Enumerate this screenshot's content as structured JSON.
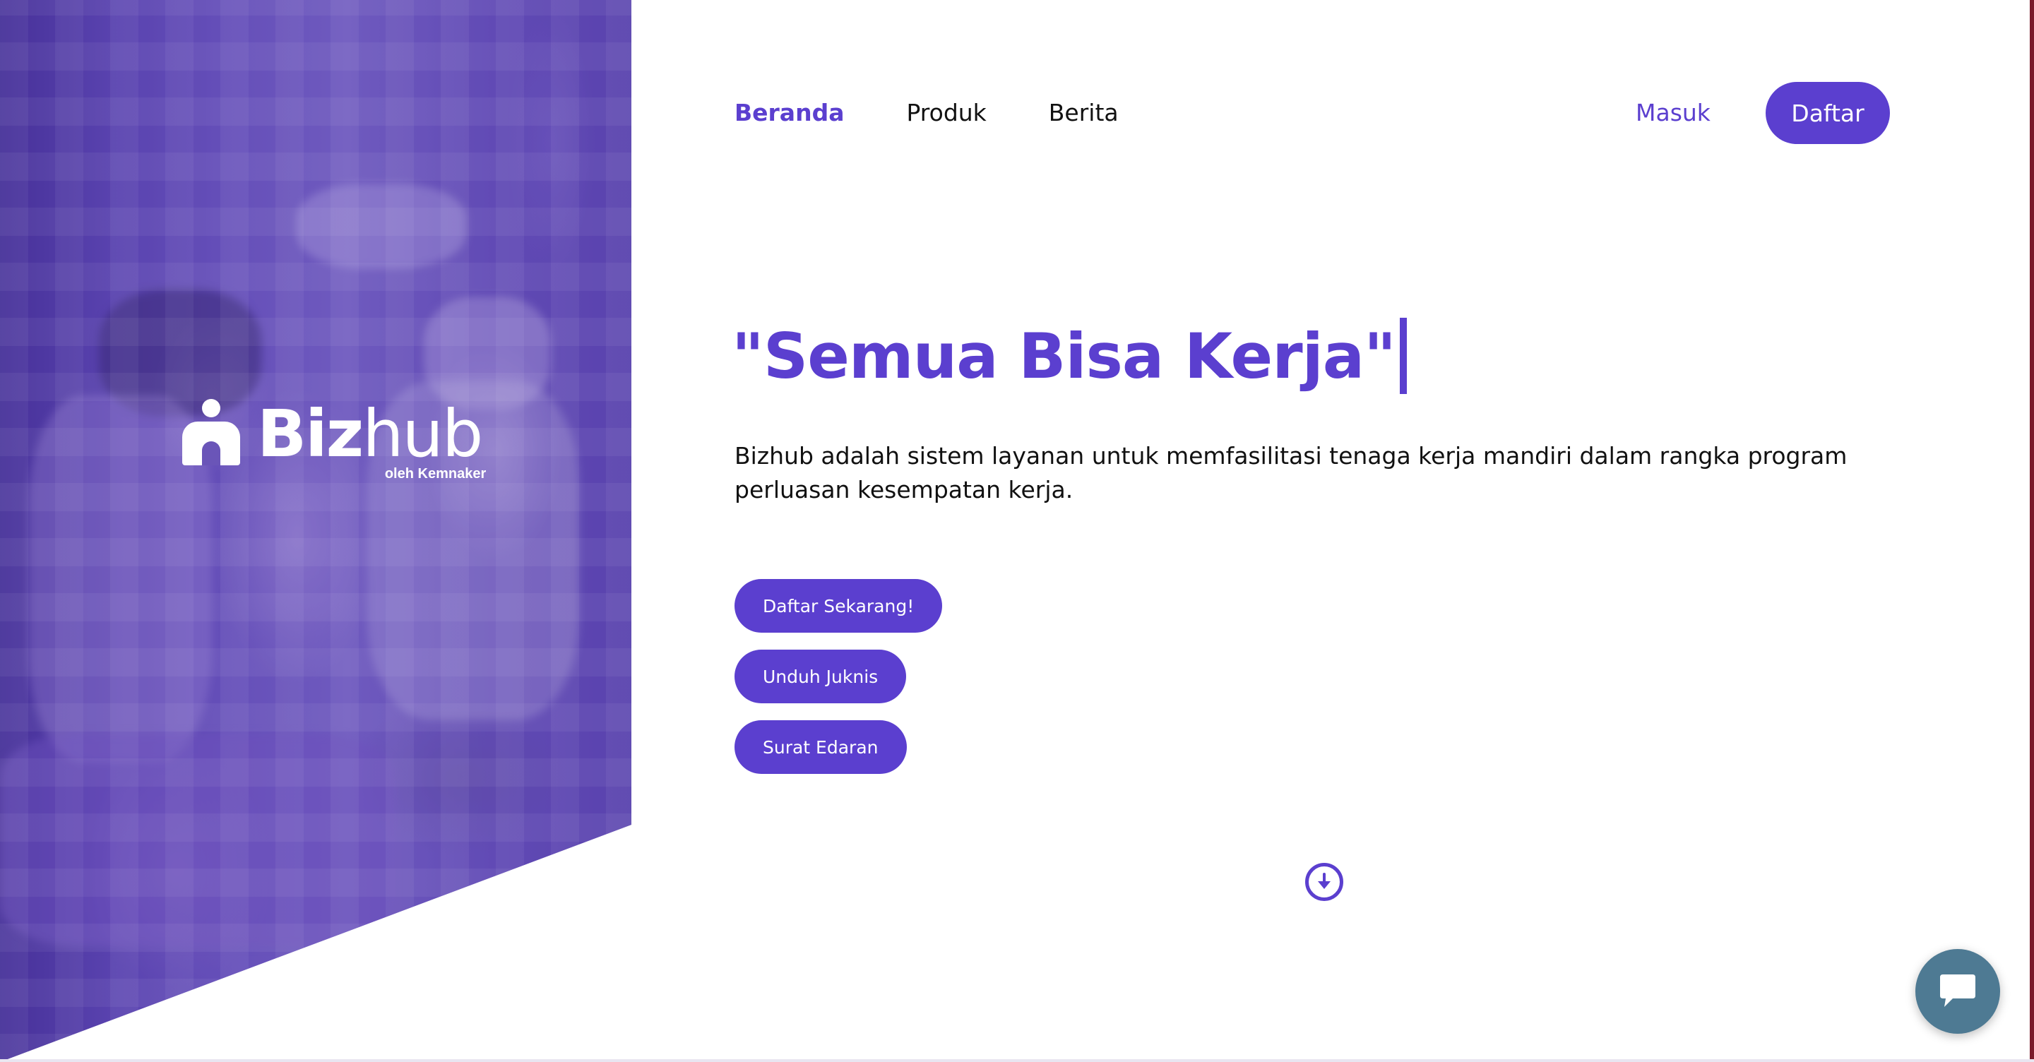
{
  "brand": {
    "name_bold": "Biz",
    "name_light": "hub",
    "tagline": "oleh Kemnaker",
    "logo_icon": "person-arch-icon"
  },
  "nav": {
    "items": [
      {
        "label": "Beranda",
        "active": true
      },
      {
        "label": "Produk",
        "active": false
      },
      {
        "label": "Berita",
        "active": false
      }
    ],
    "login_label": "Masuk",
    "signup_label": "Daftar"
  },
  "hero": {
    "headline": "\"Semua Bisa Kerja\"",
    "description": "Bizhub adalah sistem layanan untuk memfasilitasi tenaga kerja mandiri dalam rangka program perluasan kesempatan kerja.",
    "buttons": [
      {
        "label": "Daftar Sekarang!"
      },
      {
        "label": "Unduh Juknis"
      },
      {
        "label": "Surat Edaran"
      }
    ]
  },
  "icons": {
    "scroll": "arrow-down-circle-icon",
    "chat": "chat-bubble-icon"
  },
  "colors": {
    "primary": "#5b3fcf",
    "chat": "#4e7a93",
    "text": "#111111",
    "background": "#ffffff"
  }
}
